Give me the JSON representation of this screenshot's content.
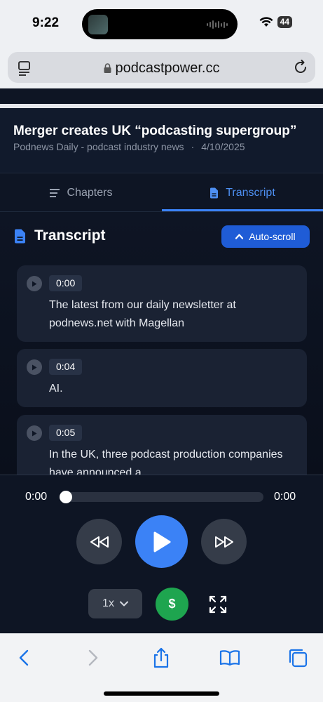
{
  "status_bar": {
    "time": "9:22",
    "battery": "44"
  },
  "browser": {
    "url": "podcastpower.cc"
  },
  "episode": {
    "title": "Merger creates UK “podcasting supergroup”",
    "podcast": "Podnews Daily - podcast industry news",
    "separator": "·",
    "date": "4/10/2025"
  },
  "tabs": [
    {
      "label": "Chapters",
      "icon": "list-icon",
      "active": false
    },
    {
      "label": "Transcript",
      "icon": "document-icon",
      "active": true
    }
  ],
  "transcript": {
    "title": "Transcript",
    "autoscroll_label": "Auto-scroll",
    "segments": [
      {
        "time": "0:00",
        "text": "The latest from our daily newsletter at podnews.net with Magellan"
      },
      {
        "time": "0:04",
        "text": "AI."
      },
      {
        "time": "0:05",
        "text": "In the UK, three podcast production companies have announced a"
      }
    ]
  },
  "player": {
    "current_time": "0:00",
    "duration": "0:00",
    "progress": 0,
    "speed": "1x",
    "tip_symbol": "$"
  },
  "colors": {
    "accent": "#3b82f6",
    "tip_green": "#1ea54f",
    "background": "#0f1624"
  }
}
